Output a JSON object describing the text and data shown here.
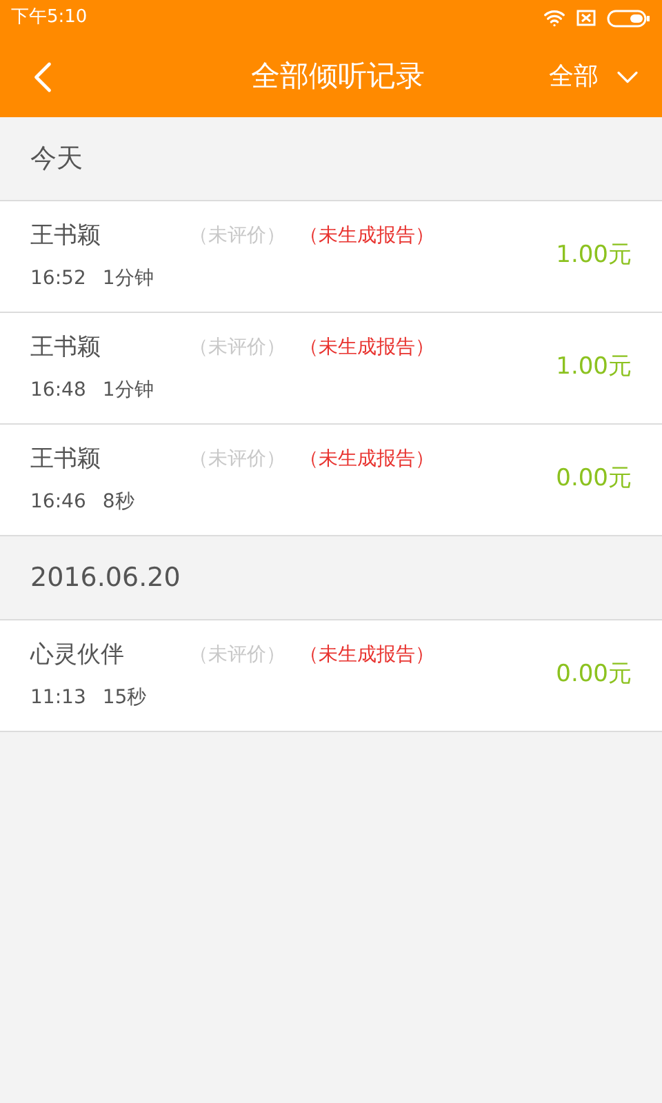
{
  "status_bar": {
    "time": "下午5:10"
  },
  "header": {
    "title": "全部倾听记录",
    "filter": "全部"
  },
  "sections": [
    {
      "heading": "今天",
      "records": [
        {
          "name": "王书颖",
          "rating": "（未评价）",
          "report": "（未生成报告）",
          "time": "16:52",
          "duration": "1分钟",
          "price": "1.00元"
        },
        {
          "name": "王书颖",
          "rating": "（未评价）",
          "report": "（未生成报告）",
          "time": "16:48",
          "duration": "1分钟",
          "price": "1.00元"
        },
        {
          "name": "王书颖",
          "rating": "（未评价）",
          "report": "（未生成报告）",
          "time": "16:46",
          "duration": "8秒",
          "price": "0.00元"
        }
      ]
    },
    {
      "heading": "2016.06.20",
      "records": [
        {
          "name": "心灵伙伴",
          "rating": "（未评价）",
          "report": "（未生成报告）",
          "time": "11:13",
          "duration": "15秒",
          "price": "0.00元"
        }
      ]
    }
  ]
}
